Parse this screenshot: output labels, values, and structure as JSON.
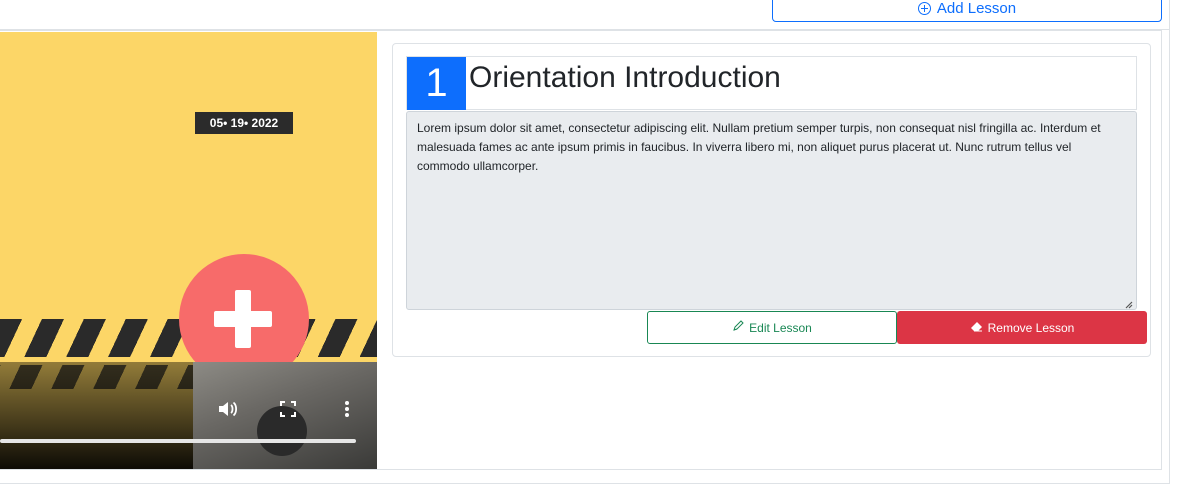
{
  "header": {
    "add_lesson_label": "Add Lesson",
    "add_icon": "plus-circle-icon"
  },
  "video": {
    "date_overlay": "05• 19• 2022",
    "progress": 0.95,
    "controls": {
      "volume_icon": "volume-icon",
      "fullscreen_icon": "fullscreen-icon",
      "menu_icon": "more-vertical-icon"
    }
  },
  "lesson": {
    "number": "1",
    "title": "Orientation Introduction",
    "description": "Lorem ipsum dolor sit amet, consectetur adipiscing elit. Nullam pretium semper turpis, non consequat nisl fringilla ac. Interdum et malesuada fames ac ante ipsum primis in faucibus. In viverra libero mi, non aliquet purus placerat ut. Nunc rutrum tellus vel commodo ullamcorper.",
    "edit_label": "Edit Lesson",
    "edit_icon": "pencil-icon",
    "remove_label": "Remove Lesson",
    "remove_icon": "eraser-icon"
  },
  "colors": {
    "primary": "#0d6efd",
    "success": "#198754",
    "danger": "#dc3545",
    "video_bg": "#fcd667",
    "accent_circle": "#f76b6a"
  }
}
